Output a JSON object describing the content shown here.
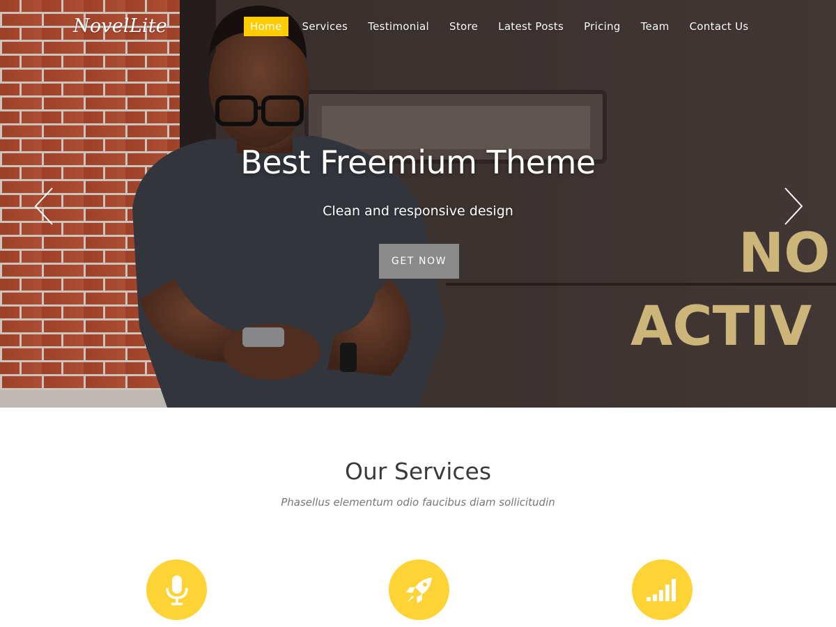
{
  "brand": {
    "logo_text": "NovelLite"
  },
  "nav": {
    "items": [
      {
        "label": "Home",
        "active": true
      },
      {
        "label": "Services",
        "active": false
      },
      {
        "label": "Testimonial",
        "active": false
      },
      {
        "label": "Store",
        "active": false
      },
      {
        "label": "Latest Posts",
        "active": false
      },
      {
        "label": "Pricing",
        "active": false
      },
      {
        "label": "Team",
        "active": false
      },
      {
        "label": "Contact Us",
        "active": false
      }
    ]
  },
  "hero": {
    "title": "Best Freemium Theme",
    "subtitle": "Clean and responsive design",
    "button_label": "GET NOW",
    "background_sign_text": [
      "NO",
      "ACTIV"
    ],
    "prev_icon": "chevron-left-icon",
    "next_icon": "chevron-right-icon"
  },
  "services": {
    "title": "Our Services",
    "subtitle": "Phasellus elementum odio faucibus diam sollicitudin",
    "icons": [
      "microphone-icon",
      "rocket-icon",
      "signal-bars-icon"
    ]
  },
  "colors": {
    "accent": "#ffcc00",
    "icon_circle": "#fdd335",
    "button_gray": "#8a8a8a",
    "heading_text": "#3a3a3a",
    "subtitle_text": "#777777"
  }
}
